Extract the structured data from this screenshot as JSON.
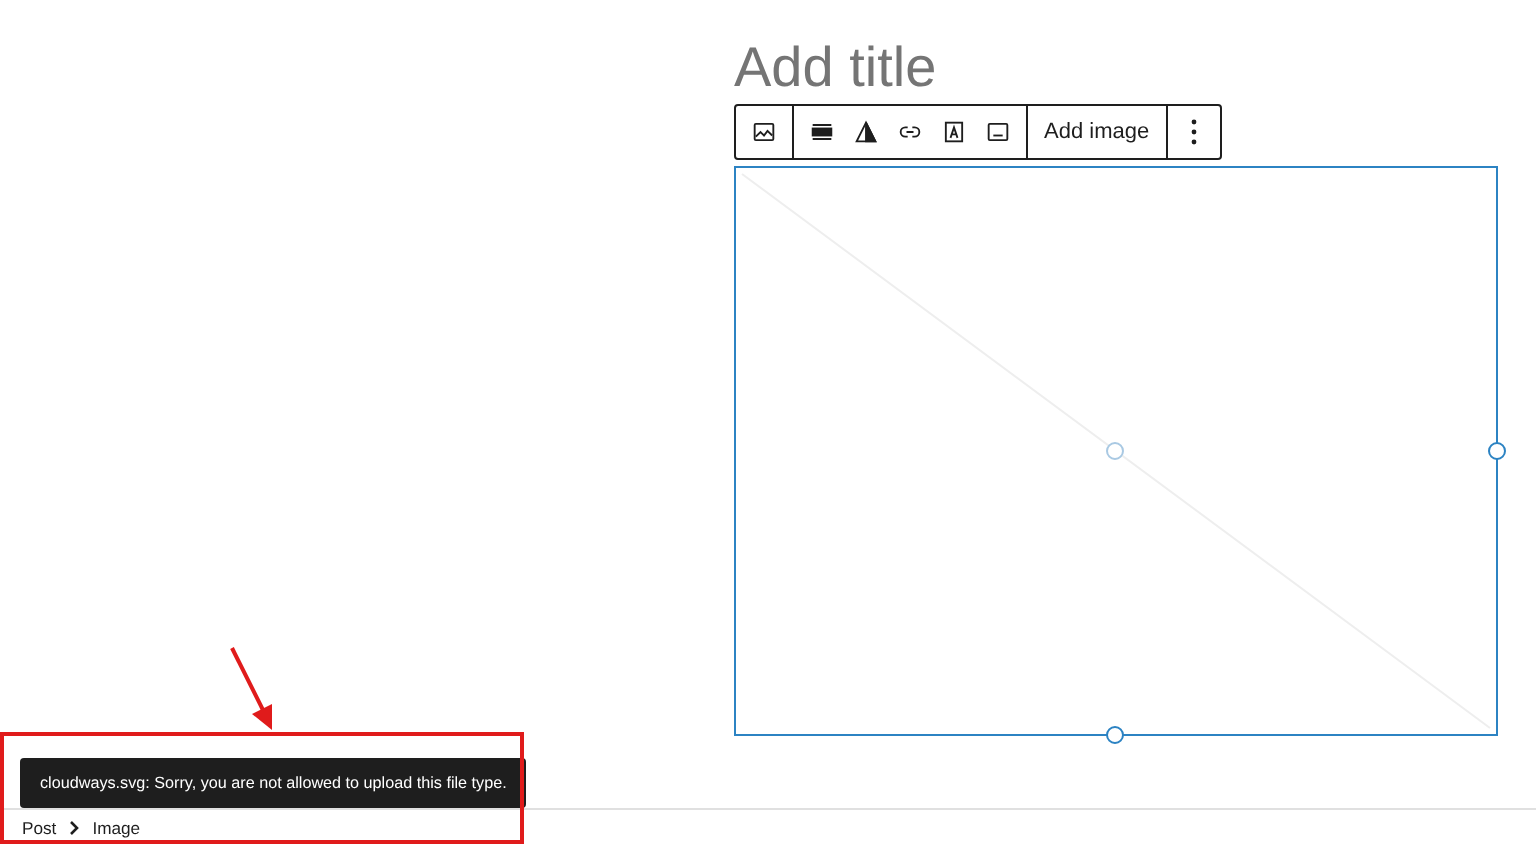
{
  "title_field": {
    "placeholder": "Add title"
  },
  "block_toolbar": {
    "button_label": "Add image"
  },
  "image_block": {
    "selected": true
  },
  "notice": {
    "message": "cloudways.svg: Sorry, you are not allowed to upload this file type."
  },
  "breadcrumb": [
    {
      "label": "Post"
    },
    {
      "label": "Image"
    }
  ]
}
